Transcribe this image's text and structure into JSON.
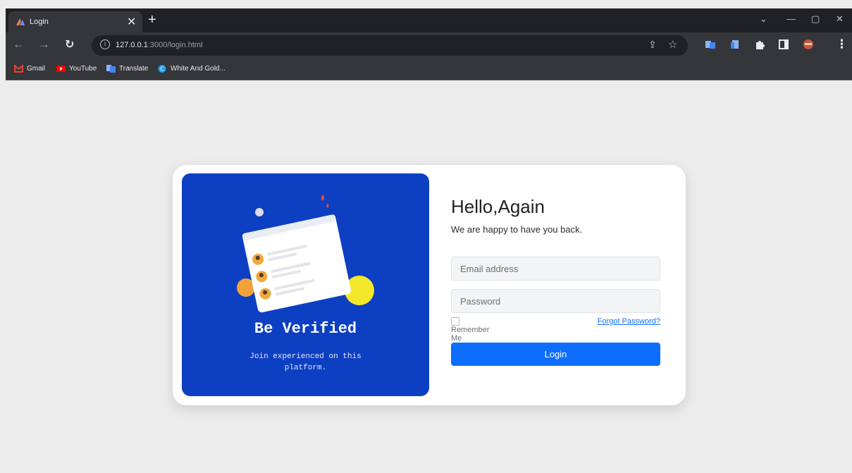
{
  "browser": {
    "tab_title": "Login",
    "url_host": "127.0.0.1",
    "url_path": ":3000/login.html",
    "bookmarks": [
      "Gmail",
      "YouTube",
      "Translate",
      "White And Gold..."
    ]
  },
  "login": {
    "panel_headline": "Be Verified",
    "panel_subtext": "Join experienced on this platform.",
    "title": "Hello,Again",
    "subtitle": "We are happy to have you back.",
    "email_placeholder": "Email address",
    "password_placeholder": "Password",
    "remember_label": "Remember Me",
    "forgot_label": "Forgot Password?",
    "login_button": "Login"
  },
  "colors": {
    "panel_blue": "#0d3fc3",
    "primary": "#0d6efd",
    "accent_yellow": "#f4e82a",
    "accent_orange": "#f3a23b"
  }
}
